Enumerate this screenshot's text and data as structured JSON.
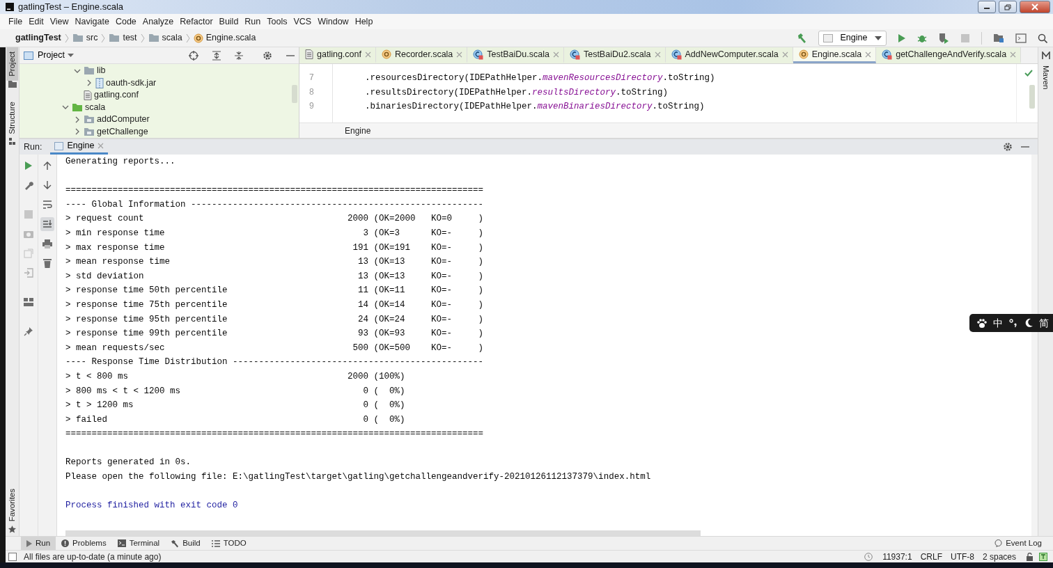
{
  "window": {
    "title": "gatlingTest – Engine.scala"
  },
  "menu": [
    "File",
    "Edit",
    "View",
    "Navigate",
    "Code",
    "Analyze",
    "Refactor",
    "Build",
    "Run",
    "Tools",
    "VCS",
    "Window",
    "Help"
  ],
  "breadcrumbs": [
    {
      "label": "gatlingTest",
      "kind": "project"
    },
    {
      "label": "src",
      "kind": "folder"
    },
    {
      "label": "test",
      "kind": "folder"
    },
    {
      "label": "scala",
      "kind": "folder"
    },
    {
      "label": "Engine.scala",
      "kind": "object"
    }
  ],
  "run_config": {
    "label": "Engine"
  },
  "stripes": {
    "left_top": [
      {
        "label": "Project",
        "selected": true
      },
      {
        "label": "Structure",
        "selected": false
      }
    ],
    "left_bottom": [
      {
        "label": "Favorites",
        "selected": false
      }
    ],
    "right": [
      {
        "label": "Maven"
      }
    ]
  },
  "project_panel": {
    "title": "Project",
    "tree": {
      "inner": [
        {
          "label": "lib",
          "kind": "folder",
          "expanded": true,
          "children": [
            {
              "label": "oauth-sdk.jar",
              "kind": "jar",
              "expanded": false
            }
          ]
        },
        {
          "label": "gatling.conf",
          "kind": "conf"
        }
      ],
      "outer": [
        {
          "label": "scala",
          "kind": "source",
          "expanded": true,
          "children": [
            {
              "label": "addComputer",
              "kind": "package",
              "expanded": false
            },
            {
              "label": "getChallenge",
              "kind": "package",
              "expanded": false
            }
          ]
        }
      ]
    }
  },
  "editor": {
    "tabs": [
      {
        "label": "gatling.conf",
        "kind": "conf",
        "selected": false
      },
      {
        "label": "Recorder.scala",
        "kind": "object",
        "selected": false
      },
      {
        "label": "TestBaiDu.scala",
        "kind": "class",
        "selected": false
      },
      {
        "label": "TestBaiDu2.scala",
        "kind": "class",
        "selected": false
      },
      {
        "label": "AddNewComputer.scala",
        "kind": "class",
        "selected": false
      },
      {
        "label": "Engine.scala",
        "kind": "object",
        "selected": true
      },
      {
        "label": "getChallengeAndVerify.scala",
        "kind": "class",
        "selected": false
      }
    ],
    "lines": [
      {
        "number": "7",
        "parts": [
          {
            "text": "    .resourcesDirectory(IDEPathHelper.",
            "kind": "plain"
          },
          {
            "text": "mavenResourcesDirectory",
            "kind": "field"
          },
          {
            "text": ".toString)",
            "kind": "plain"
          }
        ]
      },
      {
        "number": "8",
        "parts": [
          {
            "text": "    .resultsDirectory(IDEPathHelper.",
            "kind": "plain"
          },
          {
            "text": "resultsDirectory",
            "kind": "field"
          },
          {
            "text": ".toString)",
            "kind": "plain"
          }
        ]
      },
      {
        "number": "9",
        "parts": [
          {
            "text": "    .binariesDirectory(IDEPathHelper.",
            "kind": "plain"
          },
          {
            "text": "mavenBinariesDirectory",
            "kind": "field"
          },
          {
            "text": ".toString)",
            "kind": "plain"
          }
        ]
      }
    ],
    "breadcrumb": "Engine"
  },
  "run_panel": {
    "label": "Run:",
    "tab": {
      "label": "Engine"
    },
    "blocks": [
      {
        "kind": "output",
        "lines": [
          "Generating reports..."
        ]
      },
      {
        "kind": "output",
        "lines": [
          "================================================================================",
          "---- Global Information --------------------------------------------------------",
          "> request count                                       2000 (OK=2000   KO=0     )",
          "> min response time                                      3 (OK=3      KO=-     )",
          "> max response time                                    191 (OK=191    KO=-     )",
          "> mean response time                                    13 (OK=13     KO=-     )",
          "> std deviation                                         13 (OK=13     KO=-     )",
          "> response time 50th percentile                         11 (OK=11     KO=-     )",
          "> response time 75th percentile                         14 (OK=14     KO=-     )",
          "> response time 95th percentile                         24 (OK=24     KO=-     )",
          "> response time 99th percentile                         93 (OK=93     KO=-     )",
          "> mean requests/sec                                    500 (OK=500    KO=-     )",
          "---- Response Time Distribution ------------------------------------------------",
          "> t < 800 ms                                          2000 (100%)",
          "> 800 ms < t < 1200 ms                                   0 (  0%)",
          "> t > 1200 ms                                            0 (  0%)",
          "> failed                                                 0 (  0%)",
          "================================================================================"
        ]
      },
      {
        "kind": "output",
        "lines": [
          "Reports generated in 0s.",
          "Please open the following file: E:\\gatlingTest\\target\\gatling\\getchallengeandverify-20210126112137379\\index.html"
        ]
      },
      {
        "kind": "exit",
        "lines": [
          "Process finished with exit code 0"
        ]
      }
    ]
  },
  "tool_buttons": [
    {
      "label": "Run",
      "kind": "run",
      "selected": true
    },
    {
      "label": "Problems",
      "kind": "problems",
      "selected": false
    },
    {
      "label": "Terminal",
      "kind": "terminal",
      "selected": false
    },
    {
      "label": "Build",
      "kind": "build",
      "selected": false
    },
    {
      "label": "TODO",
      "kind": "todo",
      "selected": false
    }
  ],
  "event_log": "Event Log",
  "status": {
    "message": "All files are up-to-date (a minute ago)",
    "items": [
      "11937:1",
      "CRLF",
      "UTF-8",
      "2 spaces"
    ]
  },
  "ime": {
    "items": [
      {
        "kind": "paw"
      },
      {
        "kind": "text",
        "text": "中"
      },
      {
        "kind": "punct"
      },
      {
        "kind": "moon"
      },
      {
        "kind": "text",
        "text": "简"
      }
    ]
  }
}
